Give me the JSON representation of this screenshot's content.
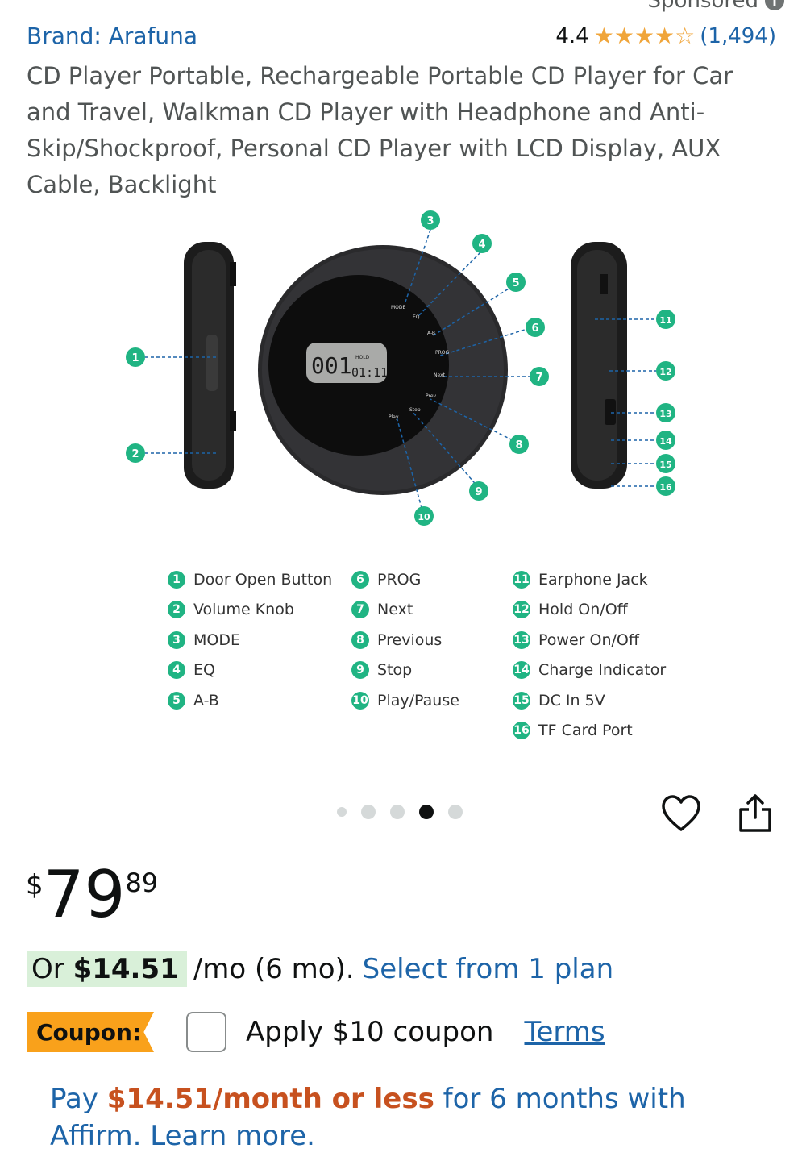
{
  "sponsored": {
    "label": "Sponsored"
  },
  "product": {
    "brand": "Brand: Arafuna",
    "rating": "4.4",
    "rating_value": 4.4,
    "review_count": "(1,494)",
    "title": "CD Player Portable, Rechargeable Portable CD Player for Car and Travel, Walkman CD Player with Headphone and Anti-Skip/Shockproof, Personal CD Player with LCD Display, AUX Cable, Backlight"
  },
  "figure": {
    "lcd_main": "001",
    "lcd_small": "01:11",
    "lcd_tag": "HOLD",
    "button_labels": [
      "MODE",
      "EQ",
      "A-B",
      "PROG",
      "Next",
      "Prev",
      "Stop",
      "Play"
    ],
    "callouts": [
      "1",
      "2",
      "3",
      "4",
      "5",
      "6",
      "7",
      "8",
      "9",
      "10",
      "11",
      "12",
      "13",
      "14",
      "15",
      "16"
    ]
  },
  "legend": {
    "col1": [
      {
        "num": "1",
        "label": "Door Open Button"
      },
      {
        "num": "2",
        "label": "Volume Knob"
      },
      {
        "num": "3",
        "label": "MODE"
      },
      {
        "num": "4",
        "label": "EQ"
      },
      {
        "num": "5",
        "label": "A-B"
      }
    ],
    "col2": [
      {
        "num": "6",
        "label": "PROG"
      },
      {
        "num": "7",
        "label": "Next"
      },
      {
        "num": "8",
        "label": "Previous"
      },
      {
        "num": "9",
        "label": "Stop"
      },
      {
        "num": "10",
        "label": "Play/Pause"
      }
    ],
    "col3": [
      {
        "num": "11",
        "label": "Earphone Jack"
      },
      {
        "num": "12",
        "label": "Hold On/Off"
      },
      {
        "num": "13",
        "label": "Power On/Off"
      },
      {
        "num": "14",
        "label": "Charge Indicator"
      },
      {
        "num": "15",
        "label": "DC In 5V"
      },
      {
        "num": "16",
        "label": "TF Card Port"
      }
    ]
  },
  "carousel": {
    "total": 5,
    "active_index": 3
  },
  "icons": {
    "favorite": "heart-icon",
    "share": "share-icon",
    "info": "info-icon",
    "star": "star-icon"
  },
  "colors": {
    "link": "#1d64a8",
    "accent_green": "#20b483",
    "star": "#f0a53a",
    "coupon": "#f9a11b",
    "affirm_amount": "#c7511f"
  },
  "price": {
    "symbol": "$",
    "whole": "79",
    "fraction": "89"
  },
  "installment": {
    "prefix": "Or",
    "amount": "$14.51",
    "terms": "/mo (6 mo).",
    "link": "Select from 1 plan"
  },
  "coupon": {
    "tag": "Coupon:",
    "text": "Apply $10 coupon",
    "terms_link": "Terms"
  },
  "affirm": {
    "pay": "Pay",
    "amount": "$14.51/month or less",
    "rest": "for 6 months with Affirm.",
    "learn_more": "Learn more."
  }
}
